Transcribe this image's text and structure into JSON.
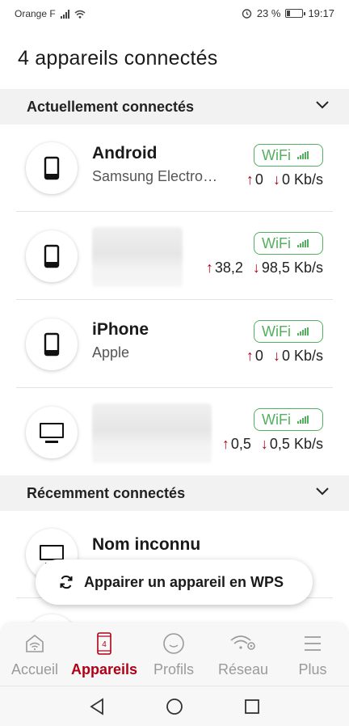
{
  "status_bar": {
    "carrier": "Orange F",
    "battery": "23 %",
    "battery_level": 0.23,
    "time": "19:17"
  },
  "page": {
    "title": "4 appareils connectés"
  },
  "sections": {
    "current": {
      "label": "Actuellement connectés"
    },
    "recent": {
      "label": "Récemment connectés"
    }
  },
  "devices": [
    {
      "name": "Android",
      "subtitle": "Samsung Electro…",
      "badge": "WiFi",
      "up": "0",
      "down": "0",
      "unit": "Kb/s",
      "icon": "smartphone-icon"
    },
    {
      "name": "",
      "subtitle": "",
      "badge": "WiFi",
      "up": "38,2",
      "down": "98,5",
      "unit": "Kb/s",
      "icon": "smartphone-icon"
    },
    {
      "name": "iPhone",
      "subtitle": "Apple",
      "badge": "WiFi",
      "up": "0",
      "down": "0",
      "unit": "Kb/s",
      "icon": "smartphone-icon"
    },
    {
      "name": "",
      "subtitle": "",
      "badge": "WiFi",
      "up": "0,5",
      "down": "0,5",
      "unit": "Kb/s",
      "icon": "monitor-icon"
    }
  ],
  "recent_devices": [
    {
      "name": "Nom inconnu",
      "icon": "monitor-icon"
    }
  ],
  "arrows": {
    "up": "↑",
    "down": "↓"
  },
  "wps_button": {
    "label": "Appairer un appareil en WPS",
    "icon": "refresh-icon"
  },
  "bottom_nav": [
    {
      "label": "Accueil",
      "icon": "home-icon",
      "active": false
    },
    {
      "label": "Appareils",
      "icon": "devices-icon",
      "badge": "4",
      "active": true
    },
    {
      "label": "Profils",
      "icon": "profile-icon",
      "active": false
    },
    {
      "label": "Réseau",
      "icon": "wifi-settings-icon",
      "active": false
    },
    {
      "label": "Plus",
      "icon": "menu-icon",
      "active": false
    }
  ],
  "colors": {
    "accent": "#b00016",
    "wifi_green": "#53b05e",
    "section_bg": "#f2f2f2"
  }
}
